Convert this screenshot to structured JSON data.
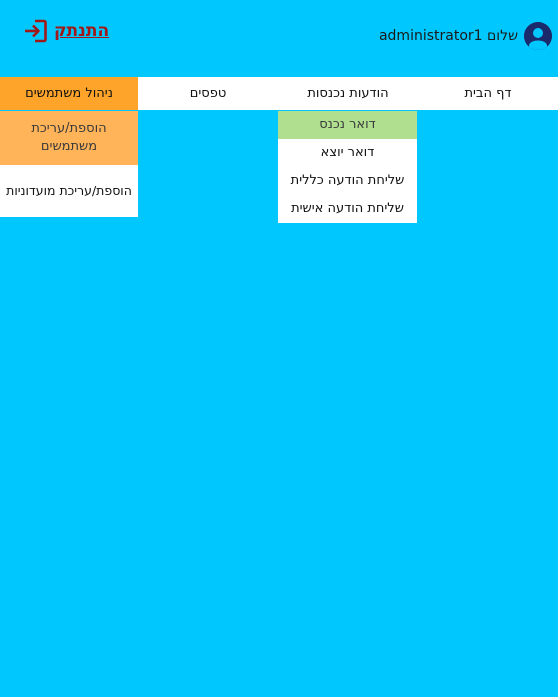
{
  "header": {
    "greeting": "שלום administrator1",
    "logout_label": "התנתק"
  },
  "nav": {
    "items": [
      {
        "label": "דף הבית"
      },
      {
        "label": "הודעות נכנסות"
      },
      {
        "label": "טפסים"
      },
      {
        "label": "ניהול משתמשים"
      }
    ]
  },
  "messages_menu": {
    "items": [
      {
        "label": "דואר נכנס"
      },
      {
        "label": "דואר יוצא"
      },
      {
        "label": "שליחת הודעה כללית"
      },
      {
        "label": "שליחת הודעה אישית"
      }
    ]
  },
  "users_menu": {
    "items": [
      {
        "label": "הוספת/עריכת משתמשים"
      },
      {
        "label": "הוספת/עריכת מועדוניות"
      }
    ]
  },
  "colors": {
    "background": "#00c8ff",
    "nav_active": "#ffa42b",
    "submenu_highlight": "#ffb45a",
    "submenu_selected": "#b0e08f",
    "logout": "#a01818"
  },
  "icons": {
    "avatar": "user-circle-icon",
    "logout": "sign-out-icon"
  }
}
